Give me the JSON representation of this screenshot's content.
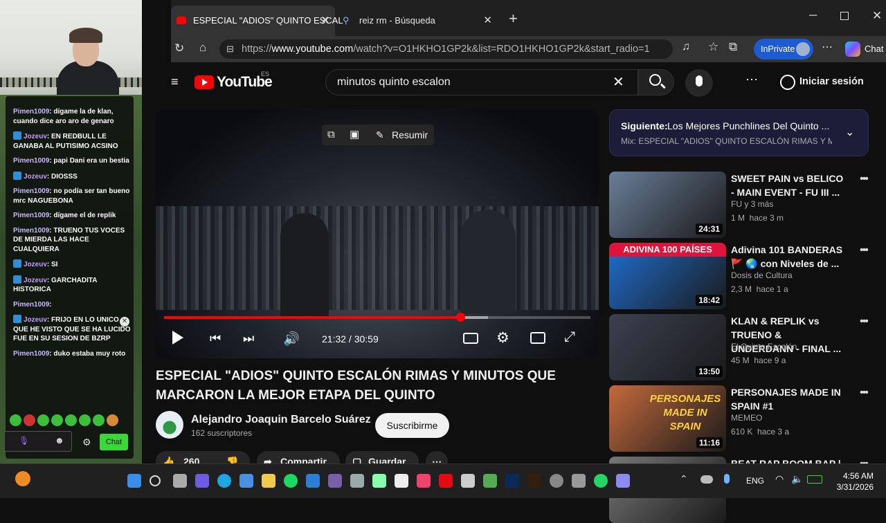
{
  "stream": {
    "chat_messages": [
      {
        "user": "Pimen1009",
        "text": "dígame la de klan, cuando dice aro aro de genaro",
        "badge": false
      },
      {
        "user": "Jozeuv",
        "text": "EN REDBULL LE GANABA AL PUTISIMO ACSINO",
        "badge": true
      },
      {
        "user": "Pimen1009",
        "text": "papi Dani era un bestia",
        "badge": false
      },
      {
        "user": "Jozeuv",
        "text": "DIOSSS",
        "badge": true
      },
      {
        "user": "Pimen1009",
        "text": "no podía ser tan bueno mrc NAGUEBONA",
        "badge": false
      },
      {
        "user": "Pimen1009",
        "text": "dígame el de replik",
        "badge": false
      },
      {
        "user": "Pimen1009",
        "text": "TRUENO TUS VOCES DE MIERDA LAS HACE CUALQUIERA",
        "badge": false
      },
      {
        "user": "Jozeuv",
        "text": "SI",
        "badge": true
      },
      {
        "user": "Jozeuv",
        "text": "GARCHADITA HISTORICA",
        "badge": true
      },
      {
        "user": "Pimen1009",
        "text": "",
        "badge": false
      },
      {
        "user": "Jozeuv",
        "text": "FRIJO EN LO UNICO QUE HE VISTO QUE SE HA LUCIDO FUE EN SU SESION DE BZRP",
        "badge": true
      },
      {
        "user": "Pimen1009",
        "text": "duko estaba muy roto",
        "badge": false
      }
    ],
    "chat_button": "Chat"
  },
  "browser": {
    "tab1_title": "ESPECIAL \"ADIOS\" QUINTO ESCAL",
    "tab2_title": "reiz rm - Búsqueda",
    "url_prefix": "https://",
    "url_domain": "www.youtube.com",
    "url_path": "/watch?v=O1HKHO1GP2k&list=RDO1HKHO1GP2k&start_radio=1",
    "inprivate": "InPrivate",
    "chat": "Chat"
  },
  "youtube": {
    "logo": "YouTube",
    "logo_region": "ES",
    "search_value": "minutos quinto escalon",
    "signin": "Iniciar sesión",
    "resumir": "Resumir",
    "time": "21:32 / 30:59",
    "progress_played": 0.695,
    "progress_buffered": 0.76,
    "video_title": "ESPECIAL \"ADIOS\" QUINTO ESCALÓN RIMAS Y MINUTOS QUE MARCARON LA MEJOR ETAPA DEL QUINTO",
    "channel": "Alejandro Joaquin Barcelo Suárez",
    "subscribers": "162 suscriptores",
    "subscribe": "Suscribirme",
    "likes": "260",
    "share": "Compartir",
    "save": "Guardar",
    "next_label": "Siguiente:",
    "next_title": "Los Mejores Punchlines Del Quinto ...",
    "mix_title": "Mix: ESPECIAL \"ADIOS\" QUINTO ESCALÓN RIMAS Y MINU",
    "related": [
      {
        "title": "SWEET PAIN vs BELICO - MAIN EVENT - FU III ...",
        "channel": "FU y 3 más",
        "meta": "1 M  hace 3 m",
        "duration": "24:31",
        "color": "#6a7f99"
      },
      {
        "title": "Adivina 101 BANDERAS 🚩 🌏 con Niveles de ...",
        "channel": "Dosis de Cultura",
        "meta": "2,3 M  hace 1 a",
        "duration": "18:42",
        "color": "#1f6fd1"
      },
      {
        "title": "KLAN & REPLIK vs TRUENO & UNDERDANN - FINAL ...",
        "channel": "El Quinto Escalón",
        "meta": "45 M  hace 9 a",
        "duration": "13:50",
        "color": "#3c4050"
      },
      {
        "title": "PERSONAJES MADE IN SPAIN #1",
        "channel": "MEMEO",
        "meta": "610 K  hace 3 a",
        "duration": "11:16",
        "color": "#c46a3c"
      },
      {
        "title": "BEAT RAP BOOM BAP |",
        "channel": "",
        "meta": "",
        "duration": "",
        "color": "#777777"
      }
    ],
    "thumb_banner": "ADIVINA 100 PAÍSES",
    "thumb_text2": "PERSONAJES MADE IN SPAIN"
  },
  "taskbar": {
    "lang": "ENG",
    "time": "4:56 AM",
    "date": "3/31/2026"
  }
}
